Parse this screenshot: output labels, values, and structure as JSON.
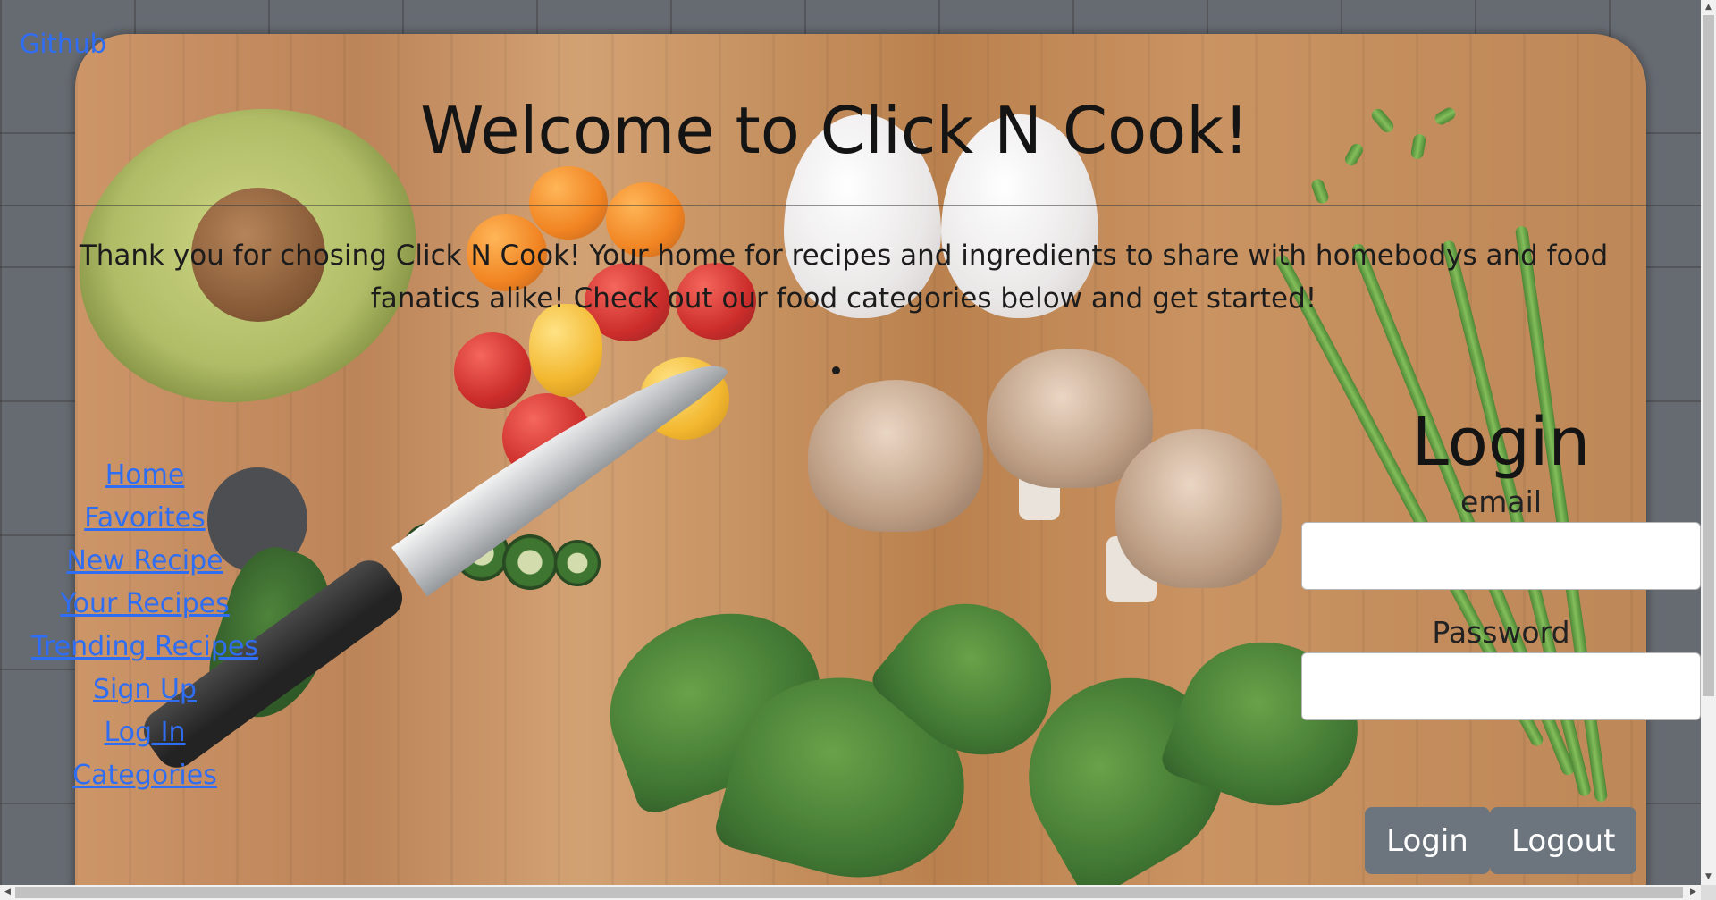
{
  "github": {
    "label": "Github"
  },
  "header": {
    "title": "Welcome to Click N Cook!"
  },
  "intro": {
    "text": "Thank you for chosing Click N Cook! Your home for recipes and ingredients to share with homebodys and food fanatics alike! Check out our food categories below and get started!"
  },
  "nav": {
    "items": [
      {
        "label": "Home"
      },
      {
        "label": "Favorites"
      },
      {
        "label": "New Recipe"
      },
      {
        "label": "Your Recipes"
      },
      {
        "label": "Trending Recipes"
      },
      {
        "label": "Sign Up"
      },
      {
        "label": "Log In"
      },
      {
        "label": "Categories"
      }
    ]
  },
  "login": {
    "title": "Login",
    "email_label": "email",
    "email_value": "",
    "password_label": "Password",
    "password_value": "",
    "login_button": "Login",
    "logout_button": "Logout"
  },
  "colors": {
    "link": "#2f6df2",
    "button": "#6c757d",
    "text": "#141414"
  },
  "scrollbars": {
    "vertical": {
      "up_icon": "scroll-up-arrow-icon",
      "down_icon": "scroll-down-arrow-icon"
    },
    "horizontal": {
      "left_icon": "scroll-left-arrow-icon",
      "right_icon": "scroll-right-arrow-icon"
    }
  }
}
